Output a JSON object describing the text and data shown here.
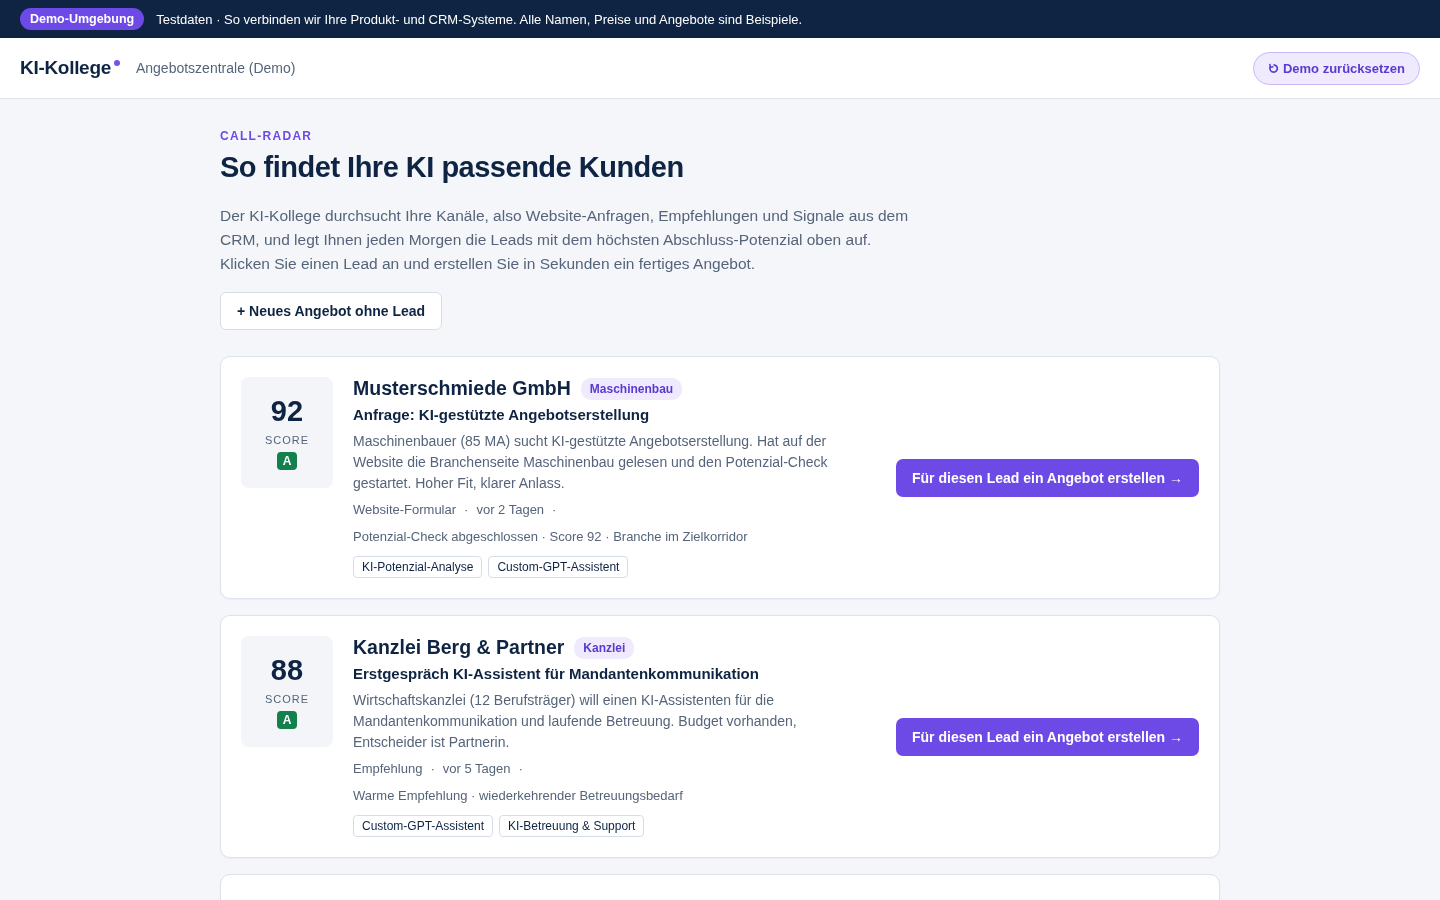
{
  "banner": {
    "badge": "Demo-Umgebung",
    "text": "Testdaten · So verbinden wir Ihre Produkt- und CRM-Systeme. Alle Namen, Preise und Angebote sind Beispiele."
  },
  "header": {
    "logo": "KI-Kollege",
    "subtitle": "Angebotszentrale (Demo)",
    "reset_button": "Demo zurücksetzen"
  },
  "intro": {
    "eyebrow": "CALL-RADAR",
    "title": "So findet Ihre KI passende Kunden",
    "description": "Der KI-Kollege durchsucht Ihre Kanäle, also Website-Anfragen, Empfehlungen und Signale aus dem CRM, und legt Ihnen jeden Morgen die Leads mit dem höchsten Abschluss-Potenzial oben auf. Klicken Sie einen Lead an und erstellen Sie in Sekunden ein fertiges Angebot.",
    "new_offer_button": "+ Neues Angebot ohne Lead"
  },
  "leads": [
    {
      "score": "92",
      "score_label": "SCORE",
      "grade": "A",
      "company": "Musterschmiede GmbH",
      "industry": "Maschinenbau",
      "subject": "Anfrage: KI-gestützte Angebotserstellung",
      "description": "Maschinenbauer (85 MA) sucht KI-gestützte Angebotserstellung. Hat auf der Website die Branchenseite Maschinenbau gelesen und den Potenzial-Check gestartet. Hoher Fit, klarer Anlass.",
      "meta": [
        "Website-Formular",
        "·",
        "vor 2 Tagen",
        "·"
      ],
      "signals": "Potenzial-Check abgeschlossen · Score 92 · Branche im Zielkorridor",
      "tags": [
        "KI-Potenzial-Analyse",
        "Custom-GPT-Assistent"
      ],
      "action": "Für diesen Lead ein Angebot erstellen →"
    },
    {
      "score": "88",
      "score_label": "SCORE",
      "grade": "A",
      "company": "Kanzlei Berg & Partner",
      "industry": "Kanzlei",
      "subject": "Erstgespräch KI-Assistent für Mandantenkommunikation",
      "description": "Wirtschaftskanzlei (12 Berufsträger) will einen KI-Assistenten für die Mandantenkommunikation und laufende Betreuung. Budget vorhanden, Entscheider ist Partnerin.",
      "meta": [
        "Empfehlung",
        "·",
        "vor 5 Tagen",
        "·"
      ],
      "signals": "Warme Empfehlung · wiederkehrender Betreuungsbedarf",
      "tags": [
        "Custom-GPT-Assistent",
        "KI-Betreuung & Support"
      ],
      "action": "Für diesen Lead ein Angebot erstellen →"
    }
  ]
}
